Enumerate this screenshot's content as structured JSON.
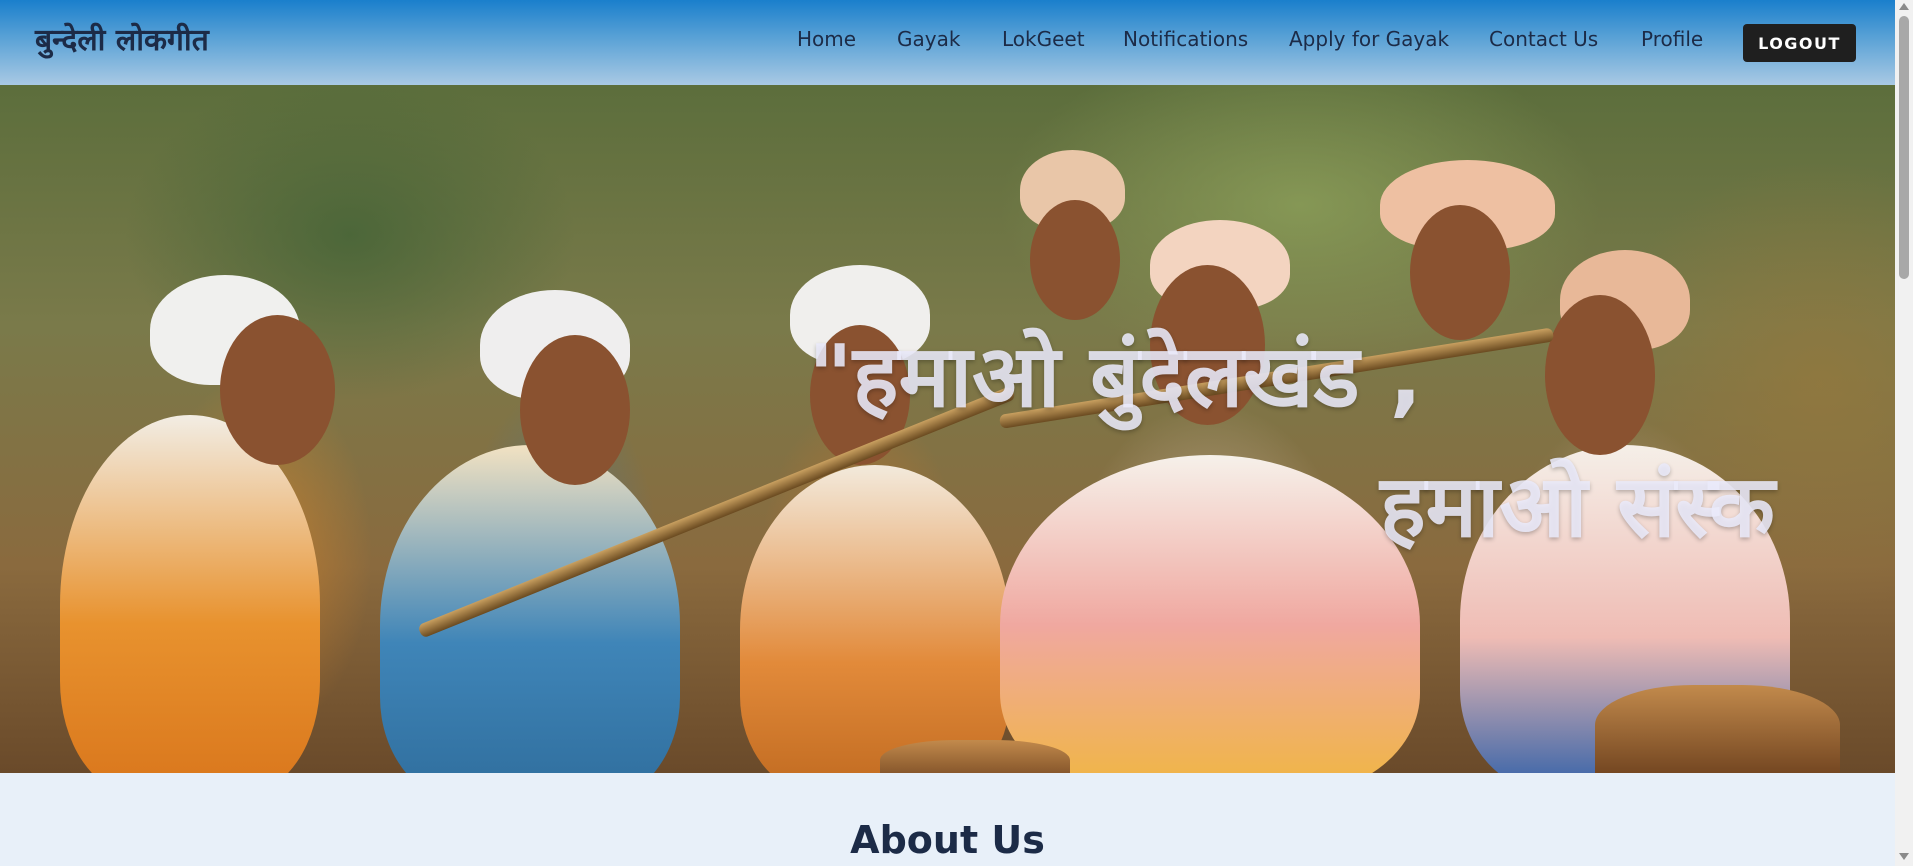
{
  "header": {
    "brand": "बुन्देली लोकगीत",
    "nav": [
      {
        "label": "Home",
        "name": "nav-home"
      },
      {
        "label": "Gayak",
        "name": "nav-gayak"
      },
      {
        "label": "LokGeet",
        "name": "nav-lokgeet"
      },
      {
        "label": "Notifications",
        "name": "nav-notifications"
      },
      {
        "label": "Apply for Gayak",
        "name": "nav-apply-for-gayak"
      },
      {
        "label": "Contact Us",
        "name": "nav-contact-us"
      },
      {
        "label": "Profile",
        "name": "nav-profile"
      }
    ],
    "logout_label": "LOGOUT"
  },
  "hero": {
    "line1": "\"हमाओ बुंदेलखंड ,",
    "line2": "हमाओ संस्क"
  },
  "about": {
    "title": "About Us"
  }
}
